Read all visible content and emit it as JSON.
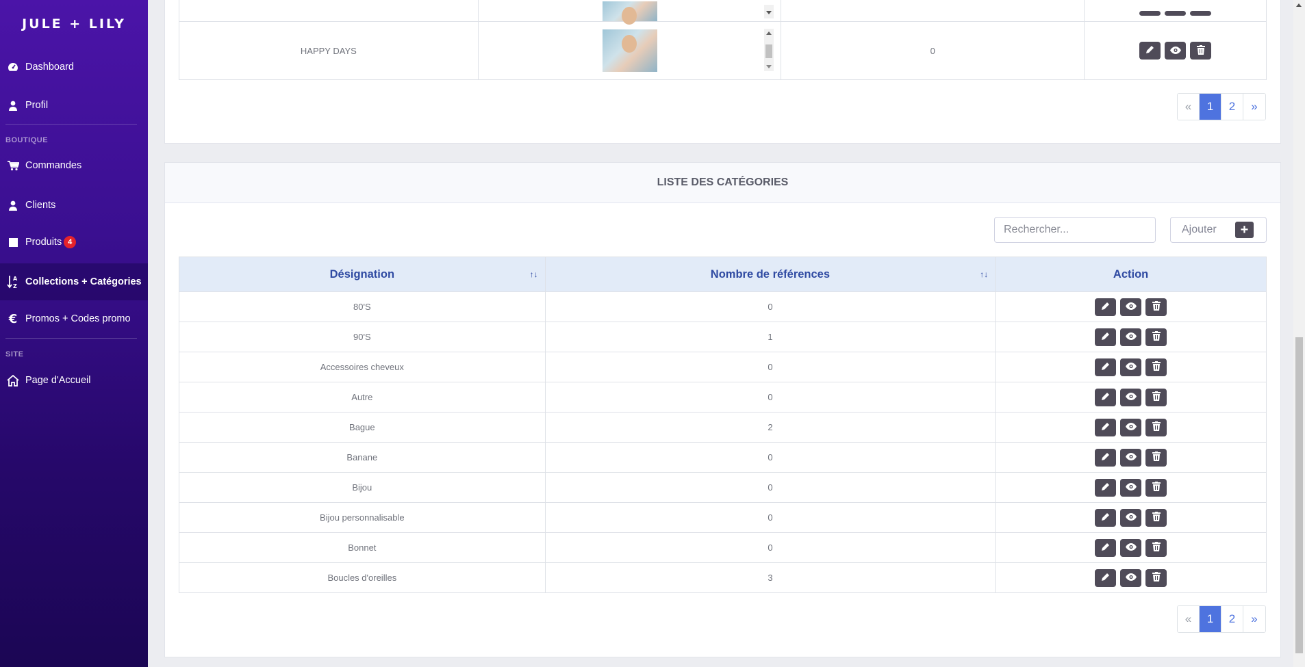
{
  "brand": "JULE + LILY",
  "sidebar": {
    "items": [
      {
        "label": "Dashboard",
        "icon": "dashboard-gauge-icon"
      },
      {
        "label": "Profil",
        "icon": "user-icon"
      },
      {
        "label": "Commandes",
        "icon": "cart-icon"
      },
      {
        "label": "Clients",
        "icon": "user-icon"
      },
      {
        "label": "Produits",
        "icon": "square-icon",
        "badge": "4"
      },
      {
        "label": "Collections + Catégories",
        "icon": "sort-alpha-icon",
        "active": true
      },
      {
        "label": "Promos + Codes promo",
        "icon": "euro-icon"
      },
      {
        "label": "Page d'Accueil",
        "icon": "home-icon"
      }
    ],
    "sections": {
      "boutique": "BOUTIQUE",
      "site": "SITE"
    }
  },
  "collections": {
    "visible_row": {
      "name": "HAPPY DAYS",
      "count": "0"
    },
    "pagination": {
      "prev": "«",
      "pages": [
        "1",
        "2"
      ],
      "current": "1",
      "next": "»"
    }
  },
  "categories": {
    "title": "LISTE DES CATÉGORIES",
    "search_placeholder": "Rechercher...",
    "add_label": "Ajouter",
    "columns": [
      "Désignation",
      "Nombre de références",
      "Action"
    ],
    "rows": [
      {
        "name": "80'S",
        "count": "0"
      },
      {
        "name": "90'S",
        "count": "1"
      },
      {
        "name": "Accessoires cheveux",
        "count": "0"
      },
      {
        "name": "Autre",
        "count": "0"
      },
      {
        "name": "Bague",
        "count": "2"
      },
      {
        "name": "Banane",
        "count": "0"
      },
      {
        "name": "Bijou",
        "count": "0"
      },
      {
        "name": "Bijou personnalisable",
        "count": "0"
      },
      {
        "name": "Bonnet",
        "count": "0"
      },
      {
        "name": "Boucles d'oreilles",
        "count": "3"
      }
    ],
    "pagination": {
      "prev": "«",
      "pages": [
        "1",
        "2"
      ],
      "current": "1",
      "next": "»"
    }
  },
  "colors": {
    "accent": "#4e73df",
    "sidebar": "#3a0f90",
    "action_button": "#4f4b58",
    "badge": "#e5232b"
  }
}
